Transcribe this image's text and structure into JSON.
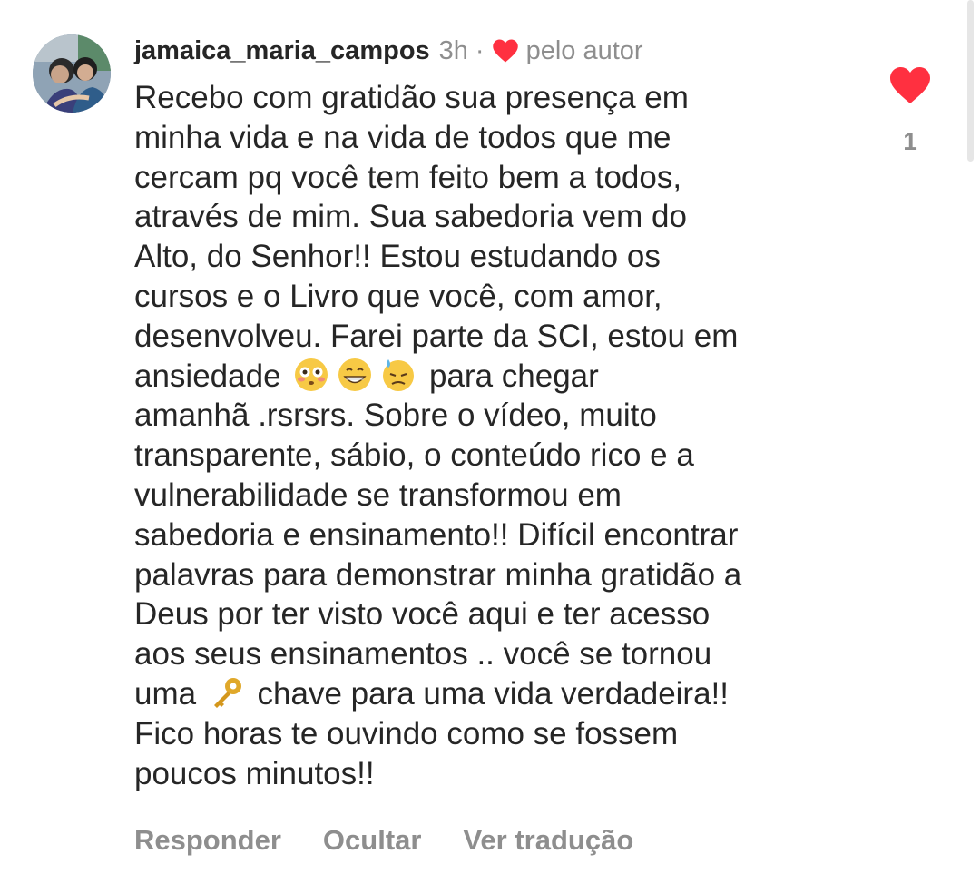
{
  "comment": {
    "username": "jamaica_maria_campos",
    "time": "3h",
    "separator": "·",
    "liked_by_author_label": "pelo autor",
    "text_lines": [
      "Recebo com gratidão sua presença em",
      "minha vida e na vida de todos que me",
      "cercam pq você tem feito bem a todos,",
      "através de mim. Sua sabedoria vem do",
      "Alto, do Senhor!! Estou estudando os",
      "cursos e o Livro  que você, com amor,",
      "desenvolveu. Farei parte da SCI, estou em"
    ],
    "line8_pre": "ansiedade ",
    "line8_post": " para chegar",
    "text_lines_b": [
      "amanhã .rsrsrs. Sobre o vídeo, muito",
      "transparente, sábio, o conteúdo rico e a",
      "vulnerabilidade se transformou em",
      "sabedoria e ensinamento!! Difícil encontrar",
      "palavras para demonstrar minha gratidão a",
      "Deus por ter visto você aqui  e ter acesso",
      "aos seus ensinamentos .. você se tornou"
    ],
    "line16_pre": "uma ",
    "line16_post": " chave para uma vida verdadeira!!",
    "text_lines_c": [
      "Fico horas te ouvindo como se fossem",
      "poucos minutos!!"
    ],
    "emojis": [
      "flushed-face",
      "grinning-face",
      "downcast-sweat-face",
      "key"
    ],
    "like_count": "1",
    "actions": {
      "reply": "Responder",
      "hide": "Ocultar",
      "translate": "Ver tradução"
    }
  },
  "colors": {
    "like_red": "#ff3040",
    "muted_gray": "#8e8e8e",
    "text_dark": "#262626"
  }
}
